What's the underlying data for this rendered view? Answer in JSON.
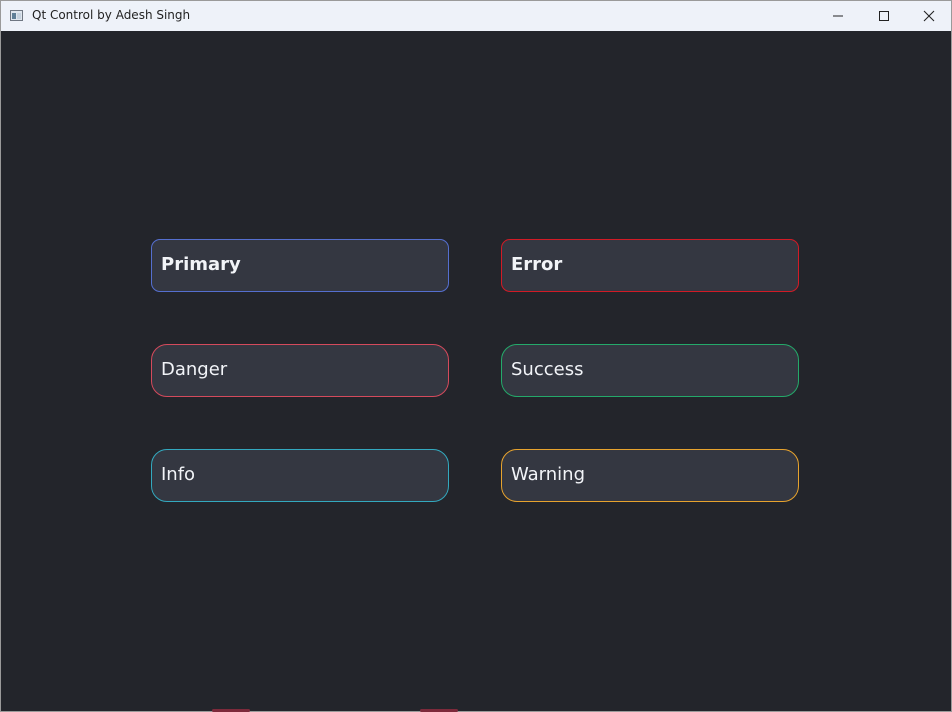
{
  "window": {
    "title": "Qt Control by Adesh Singh",
    "controls": {
      "minimize": "minimize-icon",
      "maximize": "maximize-icon",
      "close": "close-icon"
    }
  },
  "controls": [
    {
      "name": "primary",
      "label": "Primary",
      "border_color": "#556fcf",
      "bold": true
    },
    {
      "name": "error",
      "label": "Error",
      "border_color": "#d11b26",
      "bold": true
    },
    {
      "name": "danger",
      "label": "Danger",
      "border_color": "#d44a5c",
      "bold": false
    },
    {
      "name": "success",
      "label": "Success",
      "border_color": "#24a96a",
      "bold": false
    },
    {
      "name": "info",
      "label": "Info",
      "border_color": "#33a9bf",
      "bold": false
    },
    {
      "name": "warning",
      "label": "Warning",
      "border_color": "#e7a32e",
      "bold": false
    }
  ],
  "colors": {
    "window_background": "#23252b",
    "card_background": "#343741",
    "text": "#f2f4f8"
  }
}
